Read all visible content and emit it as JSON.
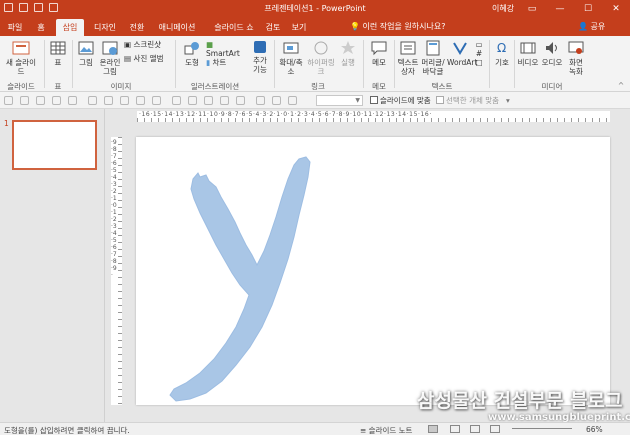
{
  "titlebar": {
    "title": "프레젠테이션1 - PowerPoint",
    "user": "이혜강",
    "minimize": "—",
    "maximize": "☐",
    "close": "✕"
  },
  "tabs": [
    "파일",
    "홈",
    "삽입",
    "디자인",
    "전환",
    "애니메이션",
    "슬라이드 쇼",
    "검토",
    "보기"
  ],
  "active_tab": "삽입",
  "tell_me": "이런 작업을 원하시나요?",
  "share": "공유",
  "ribbon": {
    "new_slide": "새 슬라이드",
    "table": "표",
    "picture": "그림",
    "online_picture": "온라인 그림",
    "screenshot": "스크린샷",
    "photo_album": "사진 앨범",
    "shapes": "도형",
    "smartart": "SmartArt",
    "chart": "차트",
    "addins": "추가 기능",
    "zoom": "확대/축소",
    "hyperlink": "하이퍼링크",
    "action": "실행",
    "comment": "메모",
    "textbox": "텍스트 상자",
    "header_footer": "머리글/바닥글",
    "wordart": "WordArt",
    "symbols": "기호",
    "video": "비디오",
    "audio": "오디오",
    "screen_recording": "화면 녹화",
    "groups": {
      "slides": "슬라이드",
      "tables": "표",
      "images": "이미지",
      "illustrations": "일러스트레이션",
      "links": "링크",
      "comments": "메모",
      "text": "텍스트",
      "media": "미디어"
    }
  },
  "drawbar": {
    "snap_to_slide": "슬라이드에 맞춤",
    "fit_selected": "선택한 개체 맞춤"
  },
  "slides_panel": {
    "slide_number": "1"
  },
  "ruler": {
    "horizontal": "·16·15·14·13·12·11·10·9·8·7·6·5·4·3·2·1·0·1·2·3·4·5·6·7·8·9·10·11·12·13·14·15·16·",
    "vertical": "·9·8·7·6·5·4·3·2·1·0·1·2·3·4·5·6·7·8·9·"
  },
  "statusbar": {
    "message": "도형을(를) 삽입하려면 클릭하여 끕니다.",
    "notes": "슬라이드 노트",
    "zoom": "66%"
  },
  "watermark": {
    "line1": "삼성물산 건설부문 블로그",
    "line2": "www.samsungblueprint.com"
  },
  "colors": {
    "accent": "#c43e1c",
    "stroke_fill": "#a9c6e6"
  }
}
